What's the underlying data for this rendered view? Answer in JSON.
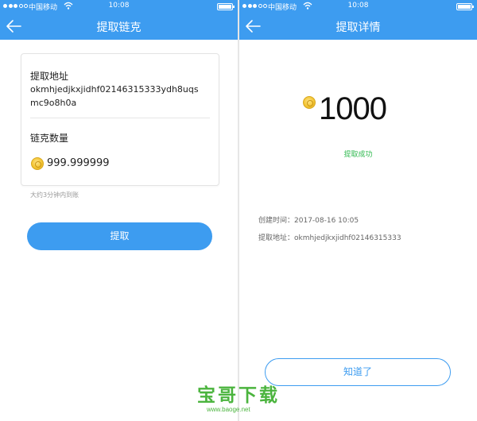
{
  "status_bar": {
    "carrier": "中国移动",
    "time": "10:08"
  },
  "withdraw_screen": {
    "title": "提取链克",
    "address_label": "提取地址",
    "address_value": "okmhjedjkxjidhf02146315333ydh8uqs mc9o8h0a",
    "amount_label": "链克数量",
    "amount_value": "999.999999",
    "hint": "大约3分钟内到账",
    "submit_label": "提取"
  },
  "detail_screen": {
    "title": "提取详情",
    "amount": "1000",
    "status": "提取成功",
    "created_label": "创建时间：",
    "created_value": "2017-08-16 10:05",
    "address_label": "提取地址：",
    "address_value": "okmhjedjkxjidhf02146315333",
    "confirm_label": "知道了"
  },
  "watermark": {
    "brand": "宝哥下载",
    "url": "www.baoge.net"
  },
  "colors": {
    "accent": "#3d9cf0",
    "success": "#2db84d",
    "coin": "#f4c534",
    "watermark": "#4bb43e"
  },
  "icons": [
    "back-arrow-icon",
    "wifi-icon",
    "battery-icon",
    "coin-icon",
    "signal-dots-icon"
  ]
}
